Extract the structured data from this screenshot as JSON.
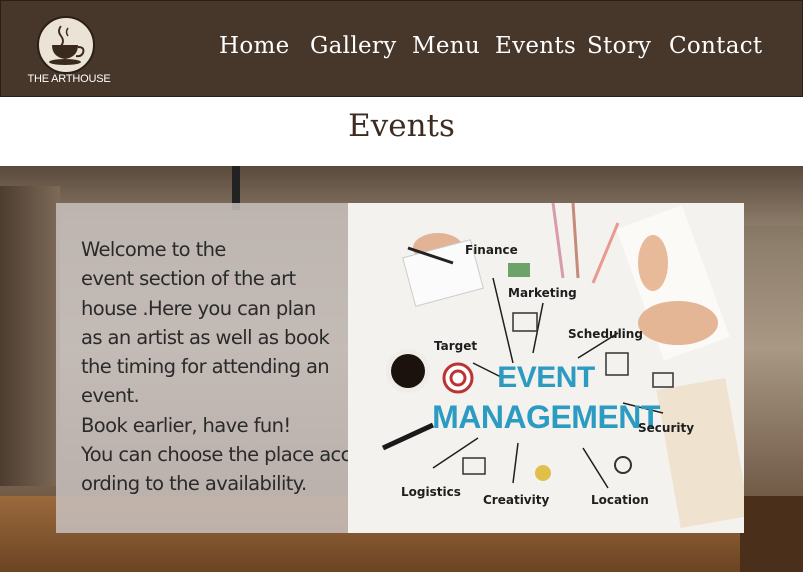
{
  "brand": {
    "name": "THE ARTHOUSE",
    "logo_icon": "coffee-cup-icon"
  },
  "nav": {
    "items": [
      {
        "label": "Home"
      },
      {
        "label": "Gallery"
      },
      {
        "label": "Menu"
      },
      {
        "label": "Events"
      },
      {
        "label": "Story"
      },
      {
        "label": "Contact"
      }
    ]
  },
  "page": {
    "title": "Events"
  },
  "intro": {
    "lines": [
      "Welcome to the",
      "event section of the art",
      "house .Here you can plan",
      "as an artist as well as book",
      "the timing for attending an",
      "event.",
      "Book earlier, have fun!",
      "You can choose the place acc",
      "ording to the availability."
    ]
  },
  "event_image": {
    "title_line1": "EVENT",
    "title_line2": "MANAGEMENT",
    "labels": {
      "finance": "Finance",
      "marketing": "Marketing",
      "scheduling": "Scheduling",
      "target": "Target",
      "security": "Security",
      "logistics": "Logistics",
      "creativity": "Creativity",
      "location": "Location"
    }
  },
  "colors": {
    "header_bg": "#47362a",
    "title_text": "#3d2c21",
    "panel_bg": "#c8c1be",
    "em_blue": "#2c9bc2"
  }
}
